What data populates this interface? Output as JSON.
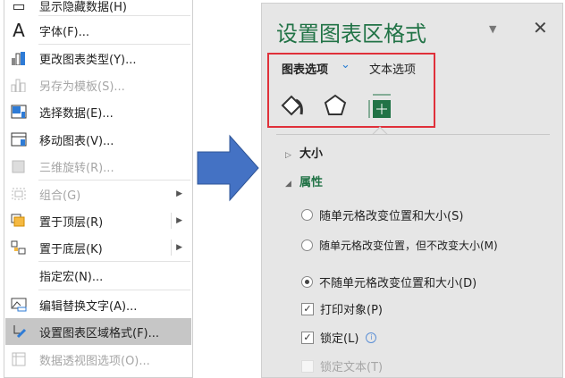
{
  "menu": {
    "items": [
      {
        "label": "显示隐藏数据(H)",
        "icon": "hidden-data-icon"
      },
      {
        "label": "字体(F)...",
        "icon": "font-icon"
      },
      {
        "label": "更改图表类型(Y)...",
        "icon": "chart-type-icon"
      },
      {
        "label": "另存为模板(S)...",
        "icon": "save-template-icon"
      },
      {
        "label": "选择数据(E)...",
        "icon": "select-data-icon"
      },
      {
        "label": "移动图表(V)...",
        "icon": "move-chart-icon"
      },
      {
        "label": "三维旋转(R)...",
        "icon": "3d-rotation-icon"
      },
      {
        "label": "组合(G)",
        "icon": "group-icon"
      },
      {
        "label": "置于顶层(R)",
        "icon": "bring-to-front-icon"
      },
      {
        "label": "置于底层(K)",
        "icon": "send-to-back-icon"
      },
      {
        "label": "指定宏(N)...",
        "icon": ""
      },
      {
        "label": "编辑替换文字(A)...",
        "icon": "alt-text-icon"
      },
      {
        "label": "设置图表区域格式(F)...",
        "icon": "format-chart-area-icon"
      },
      {
        "label": "数据透视图选项(O)...",
        "icon": "pivot-chart-options-icon"
      }
    ]
  },
  "arrow_color": "#4472c4",
  "panel": {
    "title": "设置图表区格式",
    "dropdown_icon": "▼",
    "close_icon": "✕",
    "tabs": [
      "图表选项",
      "文本选项"
    ],
    "tab_chevron": "⌄",
    "sections": [
      {
        "label": "大小",
        "expanded": false
      },
      {
        "label": "属性",
        "expanded": true
      }
    ],
    "options": {
      "radio1": "随单元格改变位置和大小(S)",
      "radio2": "随单元格改变位置，但不改变大小(M)",
      "radio3": "不随单元格改变位置和大小(D)",
      "print": "打印对象(P)",
      "lock": "锁定(L)",
      "lock_text": "锁定文本(T)"
    },
    "info_icon": "i",
    "accent": "#217346"
  }
}
